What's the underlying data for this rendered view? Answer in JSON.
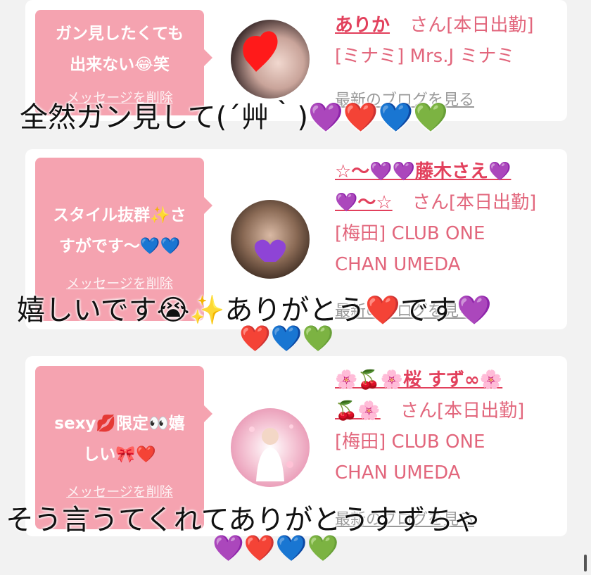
{
  "messages": [
    {
      "comment_line1": "ガン見したくても",
      "comment_line2": "出来ない😂笑",
      "delete_label": "メッセージを削除",
      "name": "ありか",
      "suffix": "さん[本日出勤]",
      "shop_line1": "[ミナミ] Mrs.J ミナミ",
      "shop_line2": "",
      "blog_label": "最新のブログを見る"
    },
    {
      "comment_line1": "スタイル抜群✨さ",
      "comment_line2": "すがです〜💙💙",
      "delete_label": "メッセージを削除",
      "name_line1": "☆〜💜💜藤木さえ💜",
      "name_line2": "💜〜☆",
      "suffix": "さん[本日出勤]",
      "shop_line1": "[梅田] CLUB ONE",
      "shop_line2": "CHAN UMEDA",
      "blog_label": "最新のブログを見る"
    },
    {
      "comment_line1": "sexy💋限定👀嬉",
      "comment_line2": "しい🎀❤️",
      "delete_label": "メッセージを削除",
      "name_line1": "🌸🍒🌸桜 すず∞🌸",
      "name_line2": "🍒🌸",
      "suffix": "さん[本日出勤]",
      "shop_line1": "[梅田] CLUB ONE",
      "shop_line2": "CHAN UMEDA",
      "blog_label": "最新のブログを見る"
    }
  ],
  "overlays": {
    "caption1": "全然ガン見して(´艸｀)💜❤️💙💚",
    "caption2": "嬉しいです😭✨ありがとう❤️です💜",
    "caption2_hearts": "❤️💙💚",
    "caption3": "そう言うてくれてありがとうすずちゃ",
    "caption3_hearts": "💜❤️💙💚"
  },
  "colors": {
    "bubble": "#f5a3b0",
    "name": "#e2405c",
    "info": "#e2667c"
  }
}
